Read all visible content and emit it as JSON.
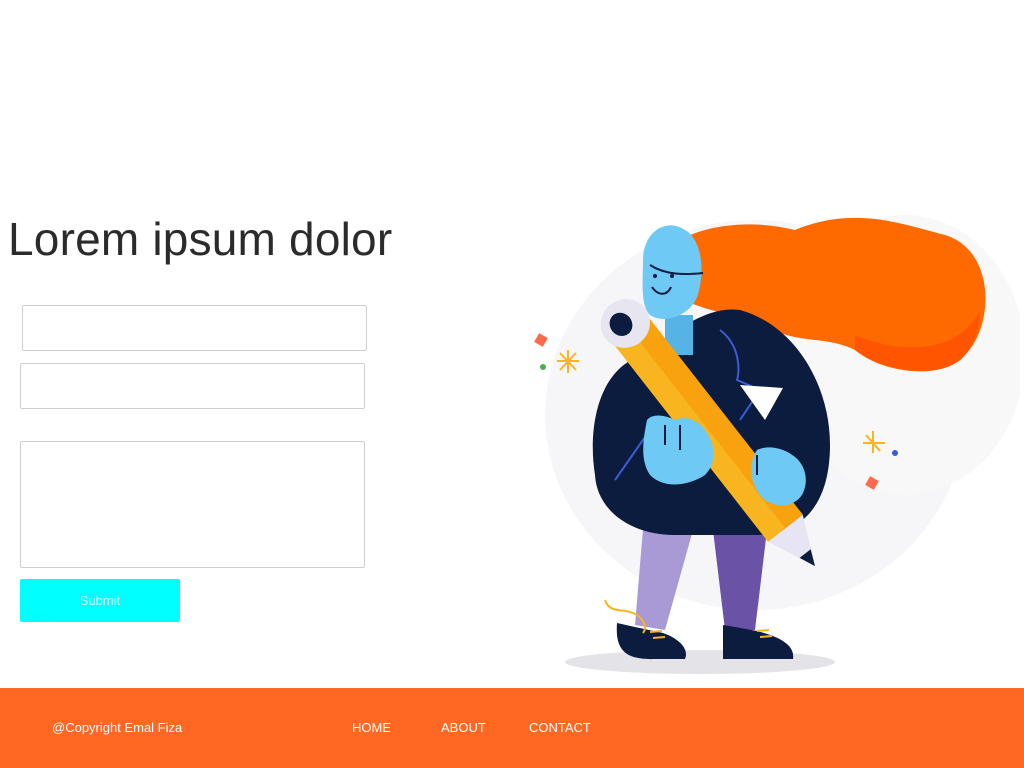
{
  "hero": {
    "title": "Lorem ipsum dolor",
    "illustration_icon": "woman-with-pencil-illustration"
  },
  "form": {
    "field1_value": "",
    "field2_value": "",
    "message_value": "",
    "submit_label": "Submit"
  },
  "footer": {
    "copyright": "@Copyright Emal Fiza",
    "nav": {
      "home": "HOME",
      "about": "ABOUT",
      "contact": "CONTACT"
    }
  },
  "colors": {
    "footer_bg": "#ff6822",
    "submit_bg": "#00ffff",
    "hair": "#ff6a00",
    "jacket": "#0c1c3f",
    "skin": "#6fc9f5",
    "pencil": "#f9b51f",
    "pants": "#7b68b6"
  }
}
